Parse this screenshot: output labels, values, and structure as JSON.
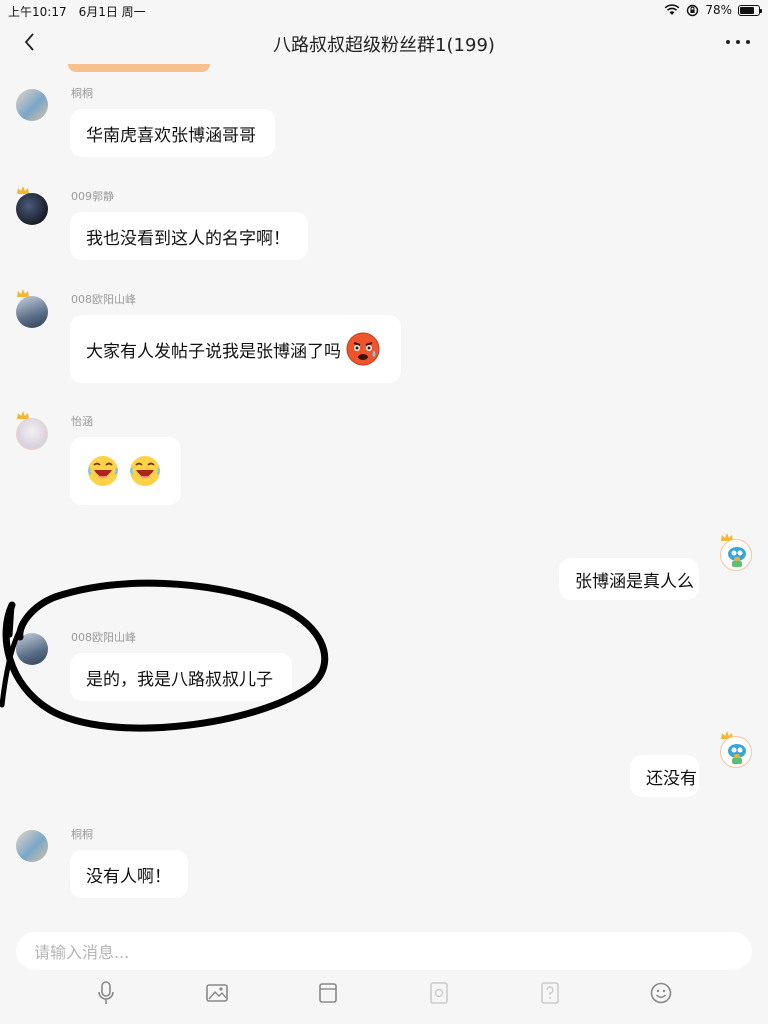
{
  "status_bar": {
    "time": "上午10:17",
    "date": "6月1日 周一",
    "battery": "78%",
    "battery_level": 0.78
  },
  "header": {
    "title": "八路叔叔超级粉丝群1(199)"
  },
  "messages": [
    {
      "sender": "桐桐",
      "text": "华南虎喜欢张博涵哥哥",
      "side": "left"
    },
    {
      "sender": "009郭静",
      "text": "我也没看到这人的名字啊！",
      "side": "left"
    },
    {
      "sender": "008欧阳山峰",
      "text": "大家有人发帖子说我是张博涵了吗",
      "side": "left",
      "emoji": "sweat-face"
    },
    {
      "sender": "怡涵",
      "text": "",
      "side": "left",
      "emoji": "laughing-face x2"
    },
    {
      "sender": "",
      "text": "张博涵是真人么",
      "side": "right"
    },
    {
      "sender": "008欧阳山峰",
      "text": "是的，我是八路叔叔儿子",
      "side": "left"
    },
    {
      "sender": "",
      "text": "还没有",
      "side": "right"
    },
    {
      "sender": "桐桐",
      "text": "没有人啊！",
      "side": "left"
    }
  ],
  "input": {
    "placeholder": "请输入消息..."
  },
  "toolbar": {
    "icons": [
      "microphone-icon",
      "image-icon",
      "cup-icon",
      "gift-icon",
      "question-icon",
      "emoji-icon"
    ]
  },
  "colors": {
    "background": "#f6f6f6",
    "bubble": "#ffffff",
    "sender": "#9a9a9a",
    "crown": "#f5b731",
    "annotation": "#000000"
  }
}
